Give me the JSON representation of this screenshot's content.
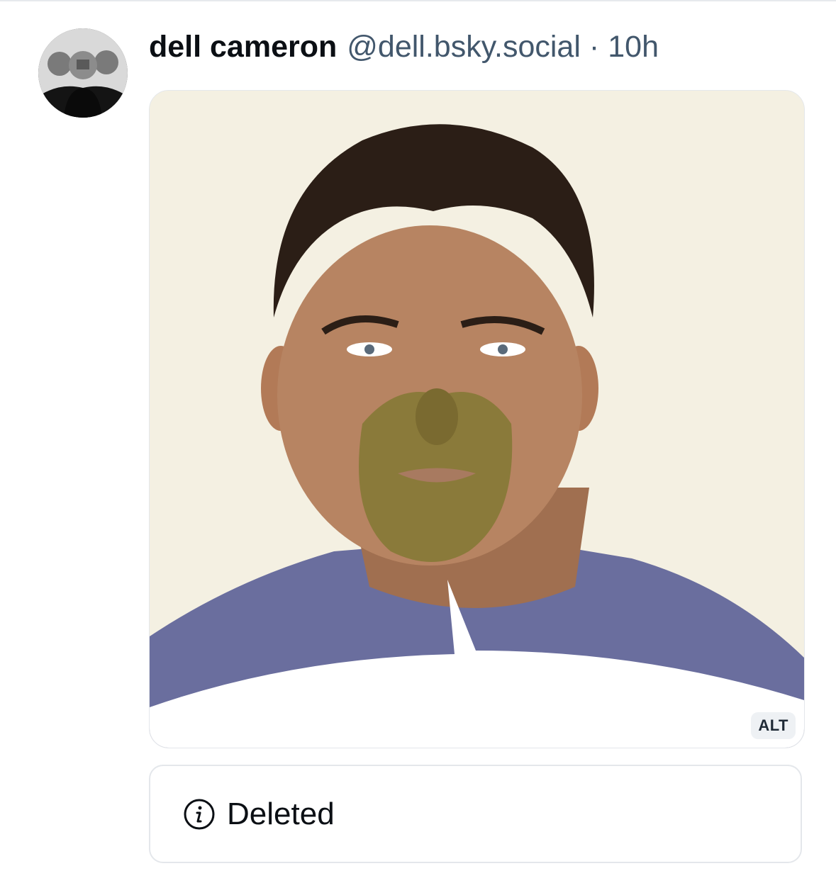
{
  "post": {
    "author_name": "dell cameron",
    "handle": "@dell.bsky.social",
    "separator": "·",
    "time": "10h"
  },
  "avatar": {
    "icon": "avatar-photo"
  },
  "media": {
    "alt_label": "ALT",
    "image_icon": "portrait-photo"
  },
  "quote": {
    "status_icon": "info-circle-icon",
    "status_text": "Deleted"
  },
  "colors": {
    "name": "#0b0f14",
    "muted": "#42576c",
    "border": "#e4e7eb"
  }
}
